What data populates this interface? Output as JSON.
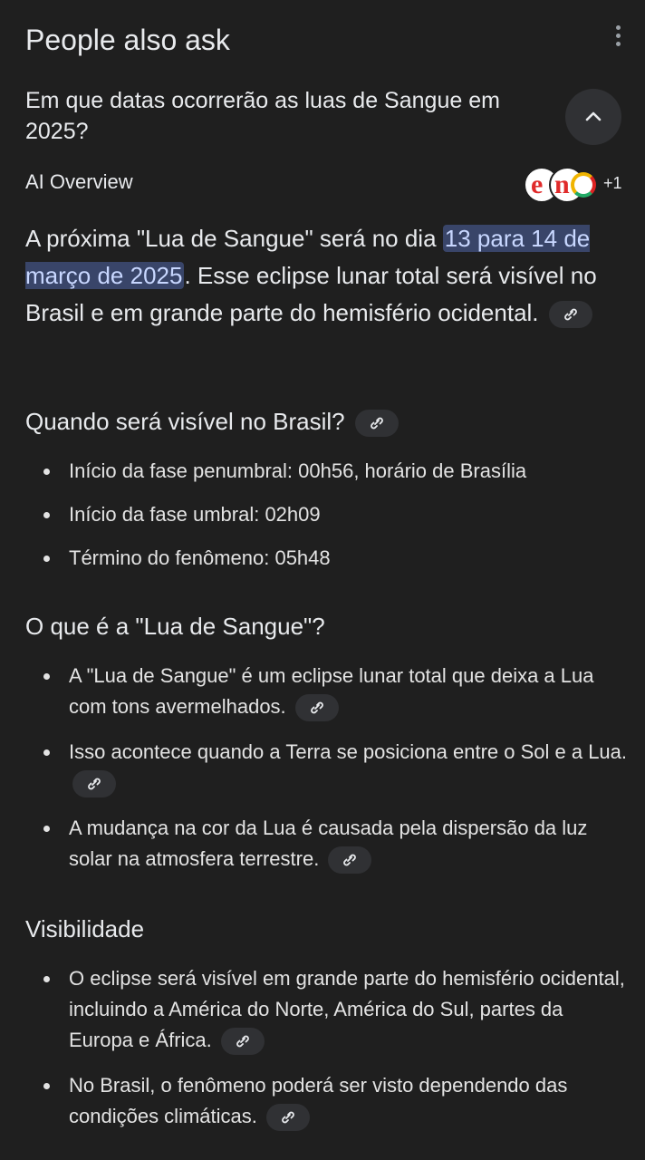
{
  "header": {
    "title": "People also ask"
  },
  "question": "Em que datas ocorrerão as luas de Sangue em 2025?",
  "ai_overview": {
    "label": "AI Overview",
    "source_more": "+1",
    "intro_before": "A próxima \"Lua de Sangue\" será no dia ",
    "intro_highlight": "13 para 14 de março de 2025",
    "intro_after": ". Esse eclipse lunar total será visível no Brasil e em grande parte do hemisfério ocidental."
  },
  "sections": [
    {
      "heading": "Quando será visível no Brasil?",
      "items": [
        "Início da fase penumbral: 00h56, horário de Brasília",
        "Início da fase umbral: 02h09",
        "Término do fenômeno: 05h48"
      ]
    },
    {
      "heading": "O que é a \"Lua de Sangue\"?",
      "items": [
        "A \"Lua de Sangue\" é um eclipse lunar total que deixa a Lua com tons avermelhados.",
        "Isso acontece quando a Terra se posiciona entre o Sol e a Lua.",
        "A mudança na cor da Lua é causada pela dispersão da luz solar na atmosfera terrestre."
      ]
    },
    {
      "heading": "Visibilidade",
      "items": [
        "O eclipse será visível em grande parte do hemisfério ocidental, incluindo a América do Norte, América do Sul, partes da Europa e África.",
        "No Brasil, o fenômeno poderá ser visto dependendo das condições climáticas."
      ]
    }
  ],
  "icons": {
    "menu": "more-vert-icon",
    "collapse": "chevron-up-icon",
    "link": "link-icon"
  },
  "colors": {
    "background": "#1f1f1f",
    "chip": "#303134",
    "highlight_bg": "#394569",
    "highlight_text": "#c8d7ff"
  }
}
